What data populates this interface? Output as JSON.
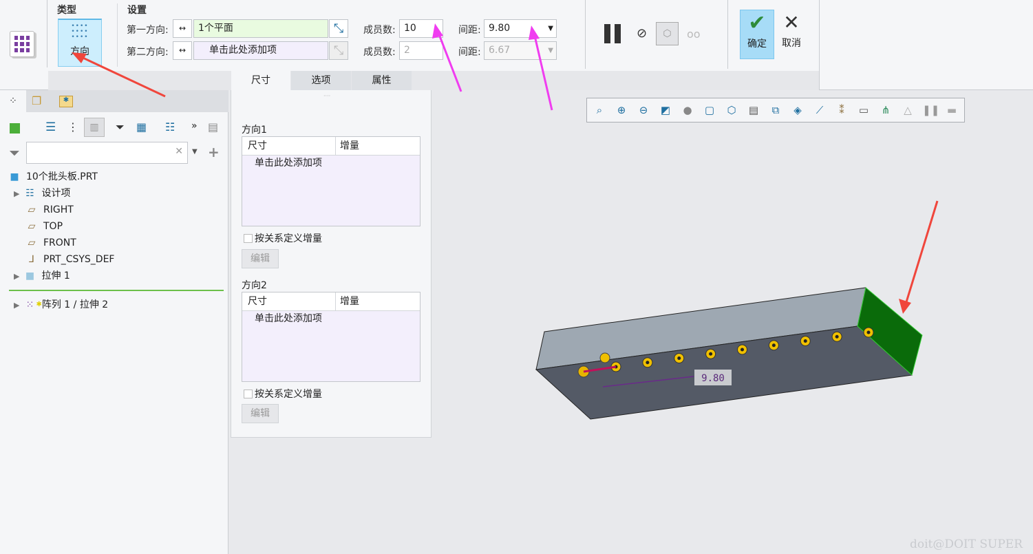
{
  "ribbon": {
    "type_label": "类型",
    "type_button": "方向",
    "settings_label": "设置",
    "dir1_label": "第一方向:",
    "dir1_value": "1个平面",
    "dir2_label": "第二方向:",
    "dir2_value": "单击此处添加项",
    "members1_label": "成员数:",
    "members1_value": "10",
    "members2_label": "成员数:",
    "members2_value": "2",
    "spacing1_label": "间距:",
    "spacing1_value": "9.80",
    "spacing2_label": "间距:",
    "spacing2_value": "6.67",
    "ok": "确定",
    "cancel": "取消",
    "tabs": [
      "尺寸",
      "选项",
      "属性"
    ]
  },
  "tree": {
    "items": [
      {
        "label": "10个批头板.PRT",
        "icon": "part-icon"
      },
      {
        "label": "设计项",
        "icon": "design-items-icon",
        "expand": true
      },
      {
        "label": "RIGHT",
        "icon": "datum-plane-icon"
      },
      {
        "label": "TOP",
        "icon": "datum-plane-icon"
      },
      {
        "label": "FRONT",
        "icon": "datum-plane-icon"
      },
      {
        "label": "PRT_CSYS_DEF",
        "icon": "csys-icon"
      },
      {
        "label": "拉伸 1",
        "icon": "extrude-icon",
        "expand": true
      },
      {
        "label": "阵列 1 / 拉伸 2",
        "icon": "pattern-icon",
        "expand": true
      }
    ]
  },
  "dash": {
    "dir1_title": "方向1",
    "dir2_title": "方向2",
    "col_dim": "尺寸",
    "col_inc": "增量",
    "add_item": "单击此处添加项",
    "relation_check": "按关系定义增量",
    "edit": "编辑"
  },
  "viewport": {
    "dimension": "9.80"
  },
  "watermark": "doit@DOIT SUPER",
  "colors": {
    "accent": "#a7dcf7",
    "annotation_red": "#f0463c",
    "annotation_magenta": "#f03cf0",
    "selected_face": "#0a6b0a"
  }
}
